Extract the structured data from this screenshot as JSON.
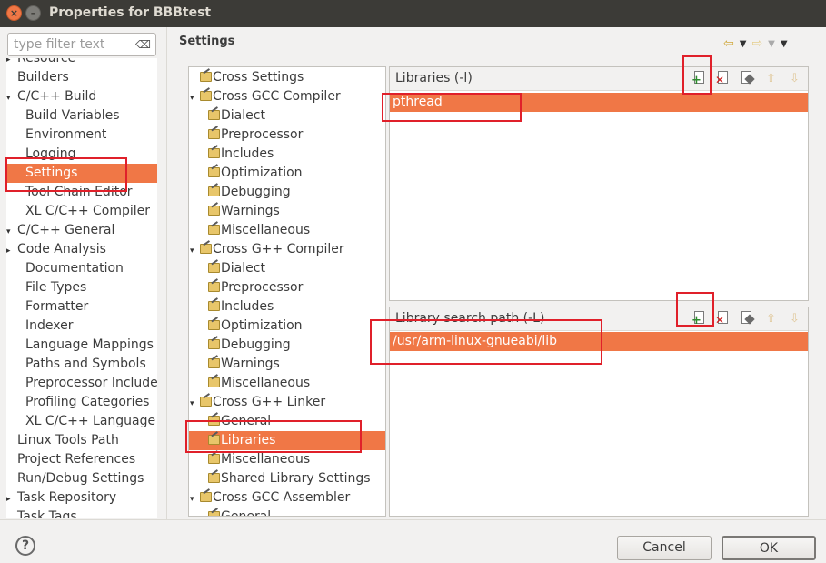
{
  "window": {
    "title": "Properties for BBBtest"
  },
  "filter": {
    "placeholder": "type filter text",
    "clear_icon": "clear-filter-icon"
  },
  "nav": {
    "items": [
      {
        "label": "Resource",
        "expander": "▸"
      },
      {
        "label": "Builders",
        "expander": ""
      },
      {
        "label": "C/C++ Build",
        "expander": "▾"
      },
      {
        "label": "Build Variables",
        "expander": ""
      },
      {
        "label": "Environment",
        "expander": ""
      },
      {
        "label": "Logging",
        "expander": ""
      },
      {
        "label": "Settings",
        "expander": "",
        "selected": true
      },
      {
        "label": "Tool Chain Editor",
        "expander": ""
      },
      {
        "label": "XL C/C++ Compiler",
        "expander": ""
      },
      {
        "label": "C/C++ General",
        "expander": "▾"
      },
      {
        "label": "Code Analysis",
        "expander": "▸"
      },
      {
        "label": "Documentation",
        "expander": ""
      },
      {
        "label": "File Types",
        "expander": ""
      },
      {
        "label": "Formatter",
        "expander": ""
      },
      {
        "label": "Indexer",
        "expander": ""
      },
      {
        "label": "Language Mappings",
        "expander": ""
      },
      {
        "label": "Paths and Symbols",
        "expander": ""
      },
      {
        "label": "Preprocessor Include",
        "expander": ""
      },
      {
        "label": "Profiling Categories",
        "expander": ""
      },
      {
        "label": "XL C/C++ Language O",
        "expander": ""
      },
      {
        "label": "Linux Tools Path",
        "expander": ""
      },
      {
        "label": "Project References",
        "expander": ""
      },
      {
        "label": "Run/Debug Settings",
        "expander": ""
      },
      {
        "label": "Task Repository",
        "expander": "▸"
      },
      {
        "label": "Task Tags",
        "expander": ""
      }
    ]
  },
  "settings": {
    "title": "Settings",
    "nav_back_icon": "back-arrow-icon",
    "nav_forward_icon": "forward-arrow-icon",
    "menu_icon": "view-menu-icon"
  },
  "tool_tree": {
    "items": [
      {
        "label": "Cross Settings",
        "expander": ""
      },
      {
        "label": "Cross GCC Compiler",
        "expander": "▾"
      },
      {
        "label": "Dialect",
        "expander": ""
      },
      {
        "label": "Preprocessor",
        "expander": ""
      },
      {
        "label": "Includes",
        "expander": ""
      },
      {
        "label": "Optimization",
        "expander": ""
      },
      {
        "label": "Debugging",
        "expander": ""
      },
      {
        "label": "Warnings",
        "expander": ""
      },
      {
        "label": "Miscellaneous",
        "expander": ""
      },
      {
        "label": "Cross G++ Compiler",
        "expander": "▾"
      },
      {
        "label": "Dialect",
        "expander": ""
      },
      {
        "label": "Preprocessor",
        "expander": ""
      },
      {
        "label": "Includes",
        "expander": ""
      },
      {
        "label": "Optimization",
        "expander": ""
      },
      {
        "label": "Debugging",
        "expander": ""
      },
      {
        "label": "Warnings",
        "expander": ""
      },
      {
        "label": "Miscellaneous",
        "expander": ""
      },
      {
        "label": "Cross G++ Linker",
        "expander": "▾"
      },
      {
        "label": "General",
        "expander": ""
      },
      {
        "label": "Libraries",
        "expander": "",
        "selected": true
      },
      {
        "label": "Miscellaneous",
        "expander": ""
      },
      {
        "label": "Shared Library Settings",
        "expander": ""
      },
      {
        "label": "Cross GCC Assembler",
        "expander": "▾"
      },
      {
        "label": "General",
        "expander": ""
      }
    ]
  },
  "libraries_panel": {
    "label": "Libraries (-l)",
    "rows": [
      "pthread"
    ]
  },
  "search_path_panel": {
    "label": "Library search path (-L)",
    "rows": [
      "/usr/arm-linux-gnueabi/lib"
    ]
  },
  "footer": {
    "help_label": "?",
    "cancel_label": "Cancel",
    "ok_label": "OK"
  }
}
